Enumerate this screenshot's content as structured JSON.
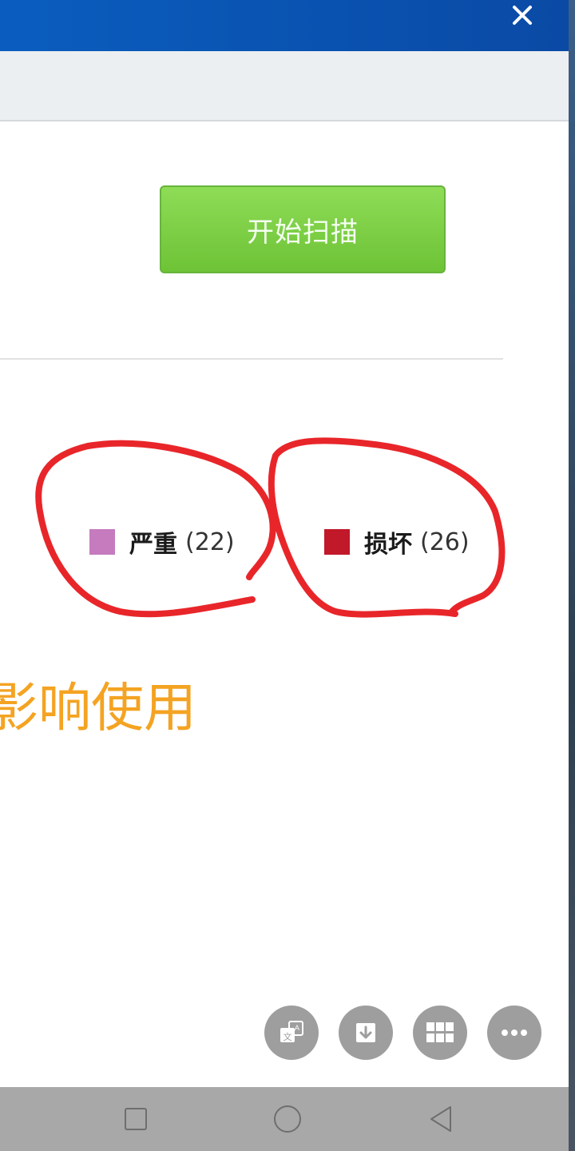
{
  "toolbar": {
    "scan_label": "开始扫描"
  },
  "legend": {
    "items": [
      {
        "label": "严重",
        "count": "(22)",
        "color": "#c57bbd"
      },
      {
        "label": "损坏",
        "count": "(26)",
        "color": "#c1182a"
      }
    ]
  },
  "warning": {
    "text": "影响使用"
  },
  "colors": {
    "titlebar": "#0a5dbf",
    "scan_button": "#7ccf42",
    "warning_text": "#f4a322",
    "annotation_stroke": "#e8262a"
  },
  "floating_actions": [
    "translate-icon",
    "download-icon",
    "grid-icon",
    "more-icon"
  ],
  "nav": [
    "recents-square-icon",
    "home-circle-icon",
    "back-triangle-icon"
  ]
}
